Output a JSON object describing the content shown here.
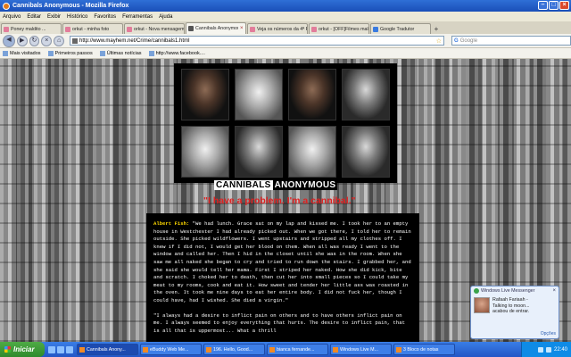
{
  "window": {
    "title": "Cannibals Anonymous - Mozilla Firefox"
  },
  "menu": [
    "Arquivo",
    "Editar",
    "Exibir",
    "Histórico",
    "Favoritos",
    "Ferramentas",
    "Ajuda"
  ],
  "tabs": [
    {
      "label": "Poney maldito ..."
    },
    {
      "label": "orkut - minha foto"
    },
    {
      "label": "orkut - Nova mensagem"
    },
    {
      "label": "Cannibals Anonymous"
    },
    {
      "label": "Veja os números da 4ª P..."
    },
    {
      "label": "orkut - [OFF]Filmes maldi..."
    },
    {
      "label": "Google Tradutor"
    }
  ],
  "nav": {
    "url": "http://www.mayhem.net/Crime/cannibals1.html",
    "search_placeholder": "Google",
    "search_engine": "G"
  },
  "bookmarks": [
    "Mais visitados",
    "Primeiros passos",
    "Últimas notícias",
    "http://www.facebook...."
  ],
  "page": {
    "brand_left": "CANNIBALS",
    "brand_right": "ANONYMOUS",
    "quote": "\"I have a problem. I'm a cannibal.\"",
    "speaker": "Albert Fish:",
    "para1": " \"We had lunch. Grace sat on my lap and kissed me. I took her to an empty house in Westchester I had already picked out. When we got there, I told her to remain outside. She picked wildflowers. I went upstairs and stripped all my clothes off. I knew if I did not, I would get her blood on them. When all was ready I went to the window and called her. Then I hid in the closet until she was in the room. When she saw me all naked she began to cry and tried to run down the stairs. I grabbed her, and she said she would tell her mama. First I striped her naked. How she did kick, bite and scratch. I choked her to death, then cut her into small pieces so I could take my meat to my rooms, cook and eat it. How sweet and tender her little ass was roasted in the oven. It took me nine days to eat her entire body. I did not fuck her, though I could have, had I wished. She died a virgin.\"",
    "para2": "\"I always had a desire to inflict pain on others and to have others inflict pain on me. I always seemed to enjoy everything that hurts. The desire to inflict pain, that is all that is uppermost... What a thrill"
  },
  "notification": {
    "app": "Windows Live Messenger",
    "line1": "Rafaah Fariaah -",
    "line2": "Talking to moon...",
    "line3": "acabou de entrar.",
    "options": "Opções"
  },
  "taskbar": {
    "start": "Iniciar",
    "tasks": [
      "Cannibals Anony...",
      "eBuddy Web Me...",
      "196. Hello, Good...",
      "bianca fernande...",
      "Windows Live M...",
      "3 Bloco de notas"
    ],
    "clock": "22:40"
  }
}
